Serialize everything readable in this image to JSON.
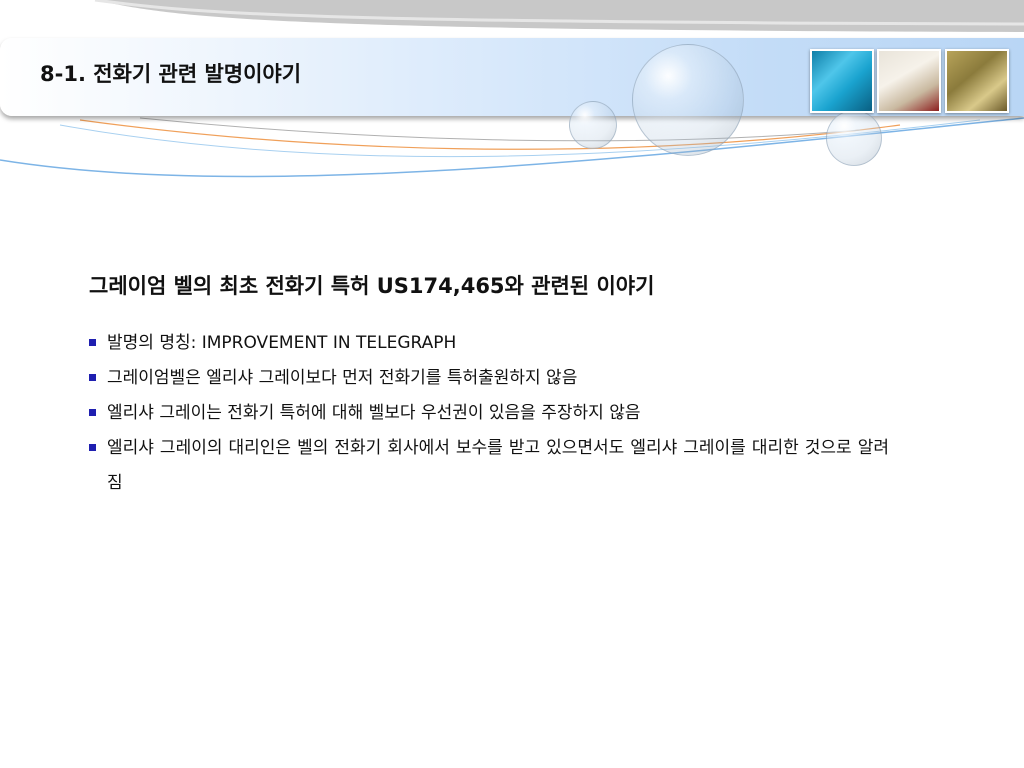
{
  "slide": {
    "title": "8-1.  전화기 관련 발명이야기",
    "thumbnails": [
      {
        "name": "fabric-thumbnail"
      },
      {
        "name": "certificate-thumbnail"
      },
      {
        "name": "textured-thumbnail"
      }
    ]
  },
  "content": {
    "heading": "그레이엄 벨의 최초 전화기 특허 US174,465와 관련된 이야기",
    "bullets": [
      "발명의 명칭: IMPROVEMENT IN TELEGRAPH",
      "그레이엄벨은 엘리샤 그레이보다 먼저 전화기를 특허출원하지 않음",
      "엘리샤 그레이는 전화기 특허에 대해 벨보다 우선권이 있음을 주장하지 않음",
      "엘리샤 그레이의 대리인은 벨의 전화기 회사에서 보수를 받고 있으면서도 엘리샤 그레이를 대리한 것으로 알려짐"
    ]
  },
  "colors": {
    "bullet_marker": "#1f1fb0",
    "title_bar": "#c3dcf7"
  }
}
